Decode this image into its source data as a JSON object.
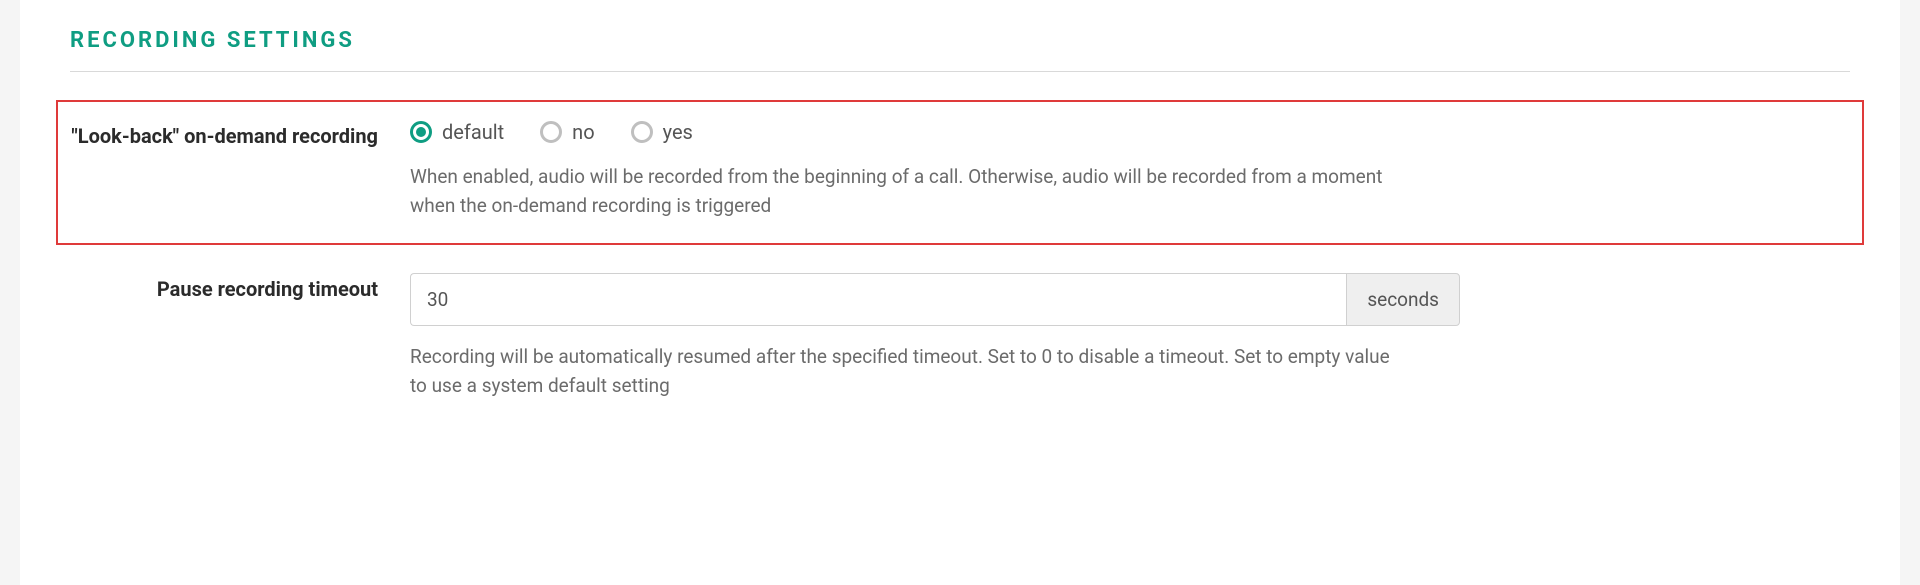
{
  "section": {
    "title": "Recording Settings"
  },
  "lookback": {
    "label": "\"Look-back\" on-demand recording",
    "options": [
      {
        "label": "default",
        "selected": true
      },
      {
        "label": "no",
        "selected": false
      },
      {
        "label": "yes",
        "selected": false
      }
    ],
    "help": "When enabled, audio will be recorded from the beginning of a call. Otherwise, audio will be recorded from a moment when the on-demand recording is triggered"
  },
  "pause_timeout": {
    "label": "Pause recording timeout",
    "value": "30",
    "addon": "seconds",
    "help": "Recording will be automatically resumed after the specified timeout. Set to 0 to disable a timeout. Set to empty value to use a system default setting"
  }
}
